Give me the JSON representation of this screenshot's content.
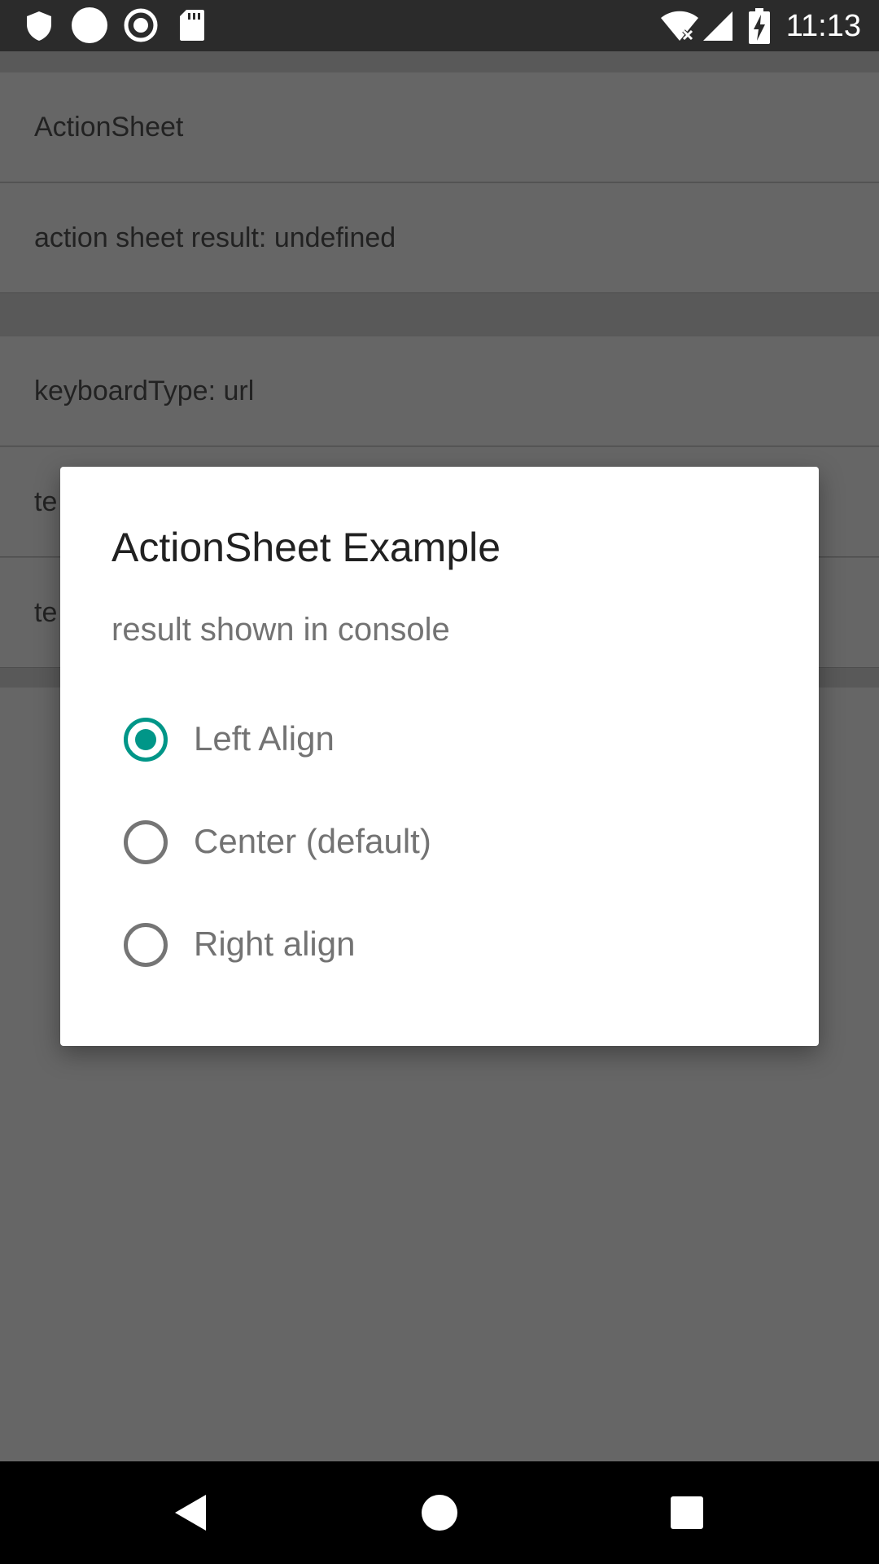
{
  "status_bar": {
    "time": "11:13",
    "left_icons": [
      "shield-icon",
      "circle-icon",
      "record-icon",
      "sd-card-icon"
    ],
    "right_icons": [
      "wifi-off-icon",
      "signal-icon",
      "battery-charging-icon"
    ]
  },
  "list": {
    "rows": [
      {
        "label": "ActionSheet"
      },
      {
        "label": "action sheet result: undefined"
      },
      {
        "label": "keyboardType: url"
      },
      {
        "label": "te"
      },
      {
        "label": "te"
      }
    ]
  },
  "dialog": {
    "title": "ActionSheet Example",
    "message": "result shown in console",
    "options": [
      {
        "label": "Left Align",
        "selected": true
      },
      {
        "label": "Center (default)",
        "selected": false
      },
      {
        "label": "Right align",
        "selected": false
      }
    ],
    "accent_color": "#009688"
  },
  "nav_bar": {
    "buttons": [
      "back-icon",
      "home-icon",
      "recents-icon"
    ]
  }
}
